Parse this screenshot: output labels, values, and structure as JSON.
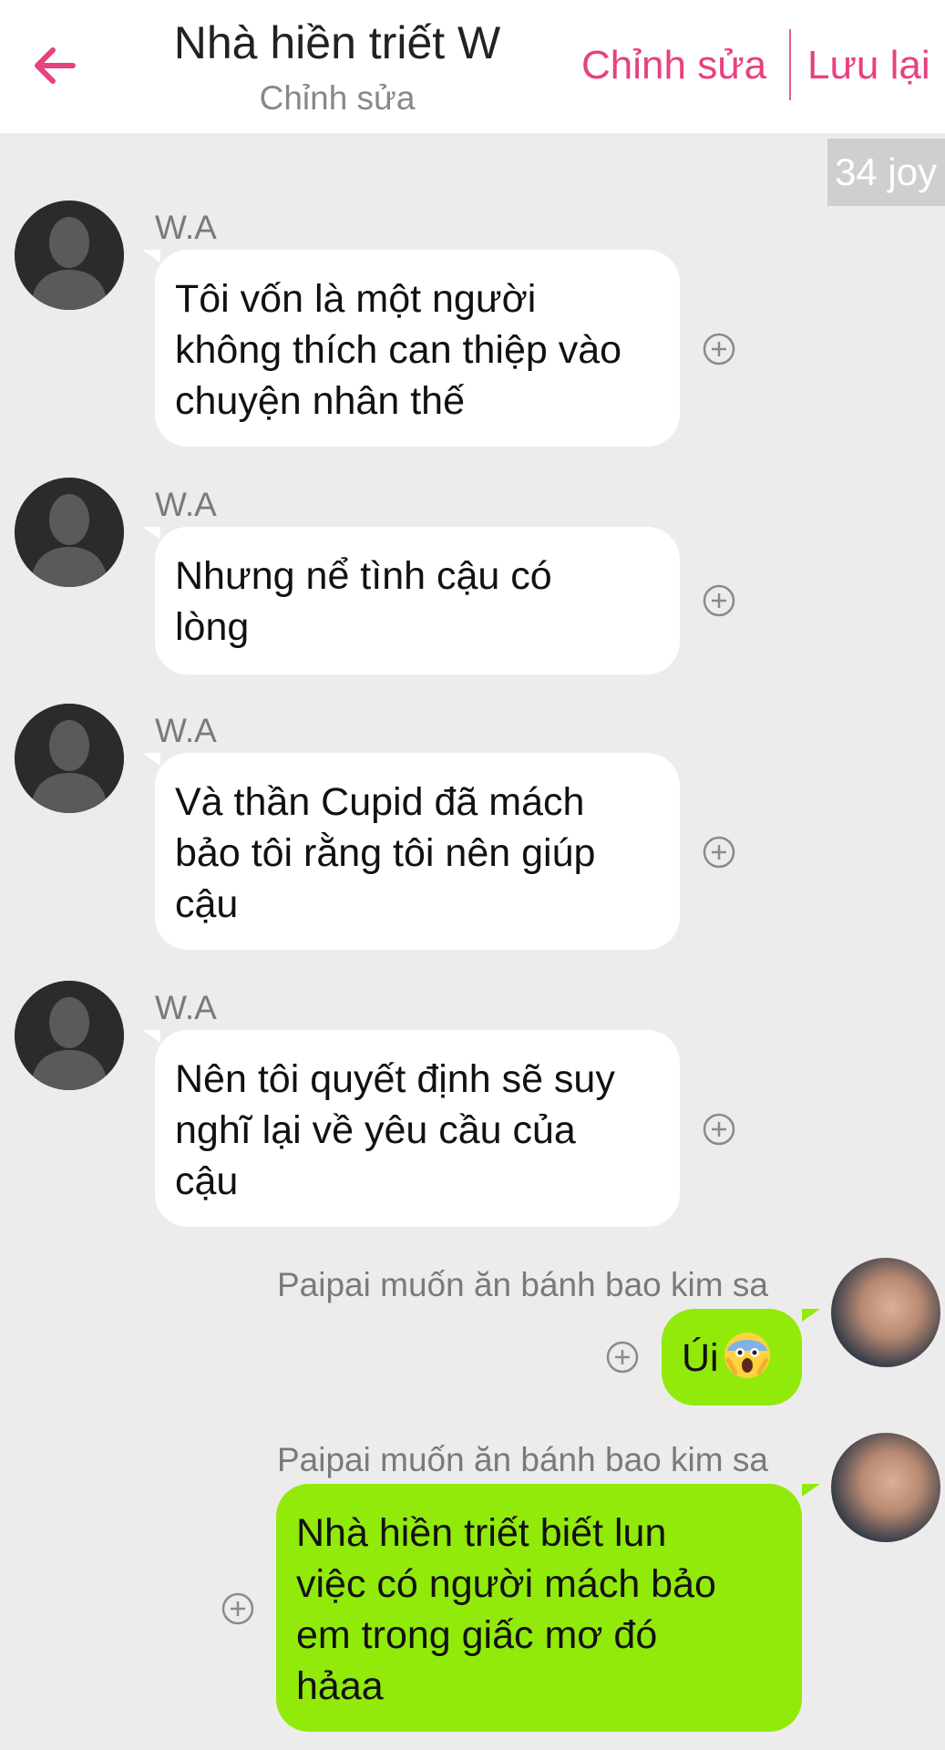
{
  "header": {
    "title": "Nhà hiền triết W",
    "subtitle": "Chỉnh sửa",
    "edit_label": "Chỉnh sửa",
    "save_label": "Lưu lại"
  },
  "counter": "34 joy",
  "messages": [
    {
      "sender": "W.A",
      "lines": [
        "Tôi vốn là một người",
        "không thích can thiệp vào",
        "chuyện nhân thế"
      ]
    },
    {
      "sender": "W.A",
      "lines": [
        "Nhưng nể tình cậu có",
        "lòng"
      ]
    },
    {
      "sender": "W.A",
      "lines": [
        "Và thần Cupid đã mách",
        "bảo tôi rằng tôi nên giúp",
        "cậu"
      ]
    },
    {
      "sender": "W.A",
      "lines": [
        "Nên tôi quyết định sẽ suy",
        "nghĩ lại về yêu cầu của",
        "cậu"
      ]
    },
    {
      "sender": "Paipai muốn ăn bánh bao kim sa",
      "lines": [
        "Úi"
      ]
    },
    {
      "sender": "Paipai muốn ăn bánh bao kim sa",
      "lines": [
        "Nhà hiền triết biết lun",
        "việc có người mách bảo",
        "em trong giấc mơ đó",
        "hảaa"
      ]
    }
  ],
  "colors": {
    "accent": "#e8417f",
    "outgoing_bubble": "#92ea0a",
    "incoming_bubble": "#ffffff",
    "background": "#ececec"
  },
  "icons": {
    "back": "arrow-left-icon",
    "add": "plus-circle-icon",
    "emoji": "screaming-face-emoji"
  }
}
